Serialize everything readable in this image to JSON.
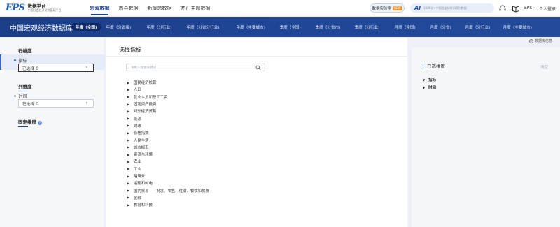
{
  "nav": {
    "logo_mark": "EPS",
    "logo_title": "数据平台",
    "logo_subtitle": "中国社会经济研究基础平台",
    "items": [
      {
        "label": "宏观数据"
      },
      {
        "label": "市县数据"
      },
      {
        "label": "新概念数据"
      },
      {
        "label": "热门主题数据"
      }
    ],
    "lab_label": "数据实验室",
    "lab_badge": "NEW",
    "ai_mark": "AI",
    "ai_placeholder": "3000亿+中国及全球时间序列数据",
    "user_label": "EPS",
    "login_label": "个人登录"
  },
  "band": {
    "title": "中国宏观经济数据库",
    "tabs": [
      {
        "label": "年度（全国)"
      },
      {
        "label": "年度（分省级)"
      },
      {
        "label": "年度（分行业)"
      },
      {
        "label": "年度（分省分行业)"
      },
      {
        "label": "年度（主要城市)"
      },
      {
        "label": "季度（全国)"
      },
      {
        "label": "季度（分省市)"
      },
      {
        "label": "季度（分行业)"
      },
      {
        "label": "月度（全国)"
      },
      {
        "label": "月度（分省)"
      },
      {
        "label": "月度（分行业)"
      },
      {
        "label": "月度（主要城市)"
      }
    ]
  },
  "sidebar": {
    "row_dim_title": "行维度",
    "row_item_label": "指标",
    "row_select": "已选择 0",
    "col_dim_title": "列维度",
    "col_item_label": "时间",
    "col_select": "已选择 0",
    "fixed_dim_title": "固定维度",
    "info_glyph": "i"
  },
  "main": {
    "title": "选择指标",
    "search_placeholder": "请输入搜索关键词",
    "tree": [
      "国民经济核算",
      "人口",
      "就业人员和职工工资",
      "固定资产投资",
      "对外经济贸易",
      "能源",
      "财政",
      "价格指数",
      "人民生活",
      "城市概况",
      "资源与环境",
      "农业",
      "工业",
      "建筑业",
      "运输和邮电",
      "国内贸易——批发、零售、住宿、餐饮和旅游",
      "金融",
      "教育和科技"
    ]
  },
  "right": {
    "db_info": "数据库信息",
    "title": "已选维度",
    "clear": "清空",
    "items": [
      {
        "label": "指标"
      },
      {
        "label": "时间"
      }
    ]
  }
}
